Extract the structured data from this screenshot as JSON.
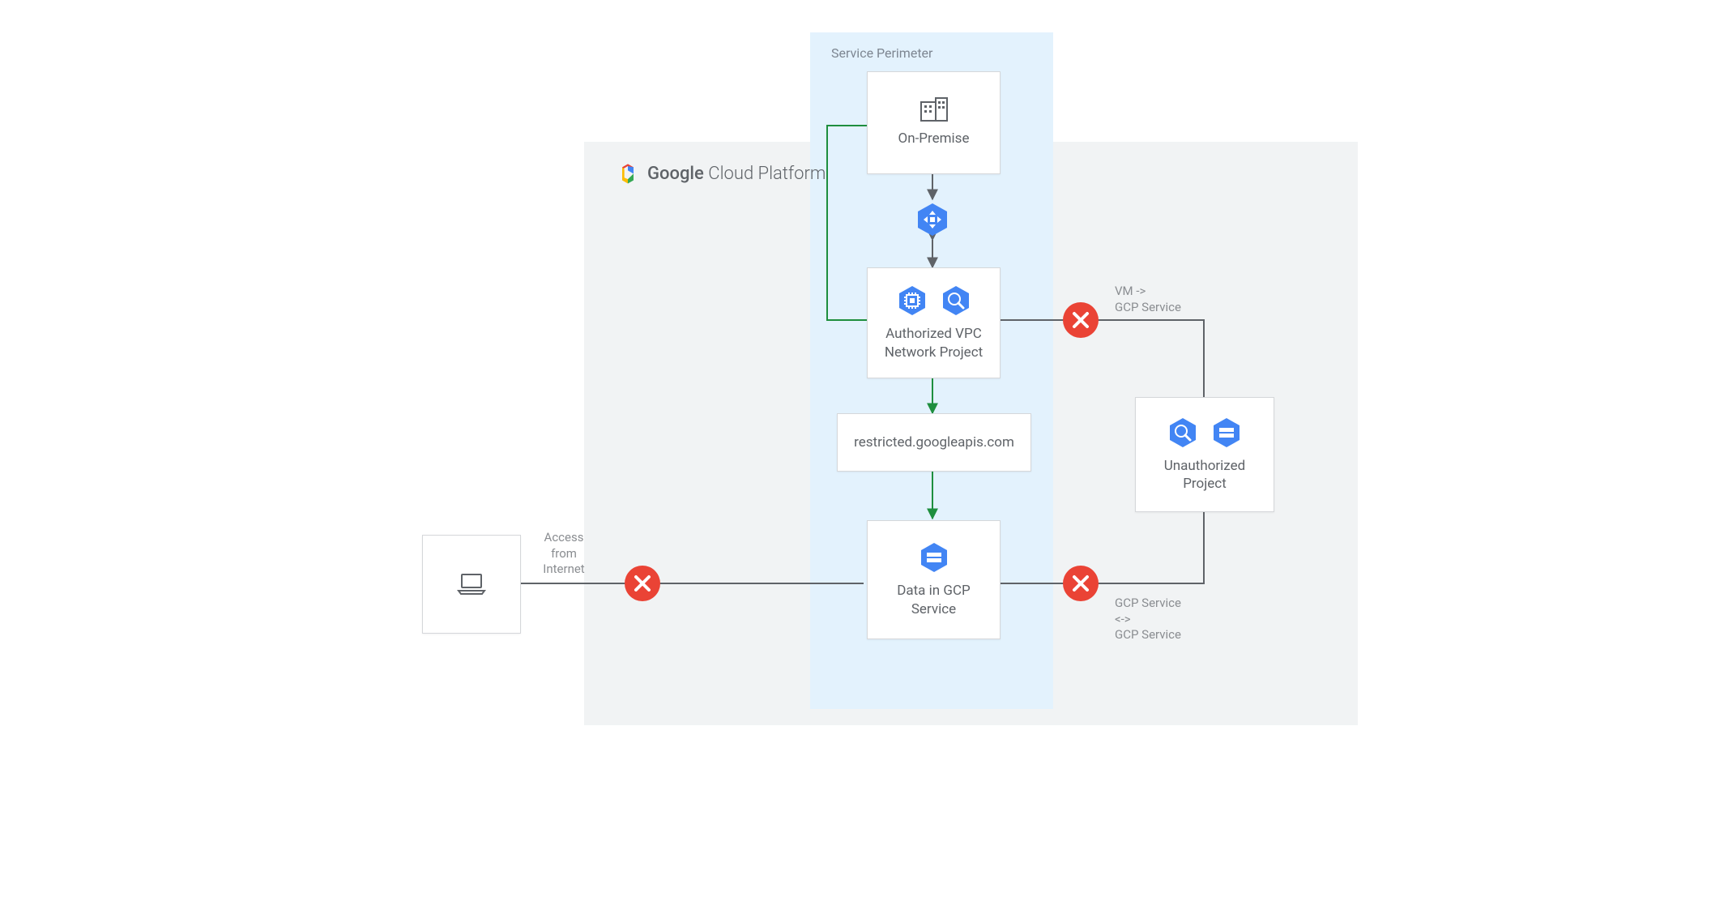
{
  "header": {
    "title_bold": "Google",
    "title_light": "Cloud Platform"
  },
  "perimeter": {
    "label": "Service Perimeter"
  },
  "nodes": {
    "onprem": {
      "label": "On-Premise"
    },
    "authvpc": {
      "label": "Authorized VPC\nNetwork Project"
    },
    "restricted": {
      "label": "restricted.googleapis.com"
    },
    "datagcp": {
      "label": "Data in GCP\nService"
    },
    "unauth": {
      "label": "Unauthorized\nProject"
    }
  },
  "annotations": {
    "access": "Access\nfrom\nInternet",
    "vm_to_svc": "VM ->\nGCP Service",
    "svc_to_svc": "GCP Service\n<->\nGCP Service"
  },
  "icons": {
    "laptop": "laptop-icon",
    "onprem": "building-icon",
    "transfer": "interconnect-icon",
    "compute": "compute-icon",
    "bigquery": "bigquery-icon",
    "storage": "storage-icon",
    "deny": "deny-icon"
  },
  "colors": {
    "blue": "#4285f4",
    "green": "#1e8e3e",
    "red": "#ea4335",
    "grey": "#5f6368",
    "line": "#5f6368"
  }
}
